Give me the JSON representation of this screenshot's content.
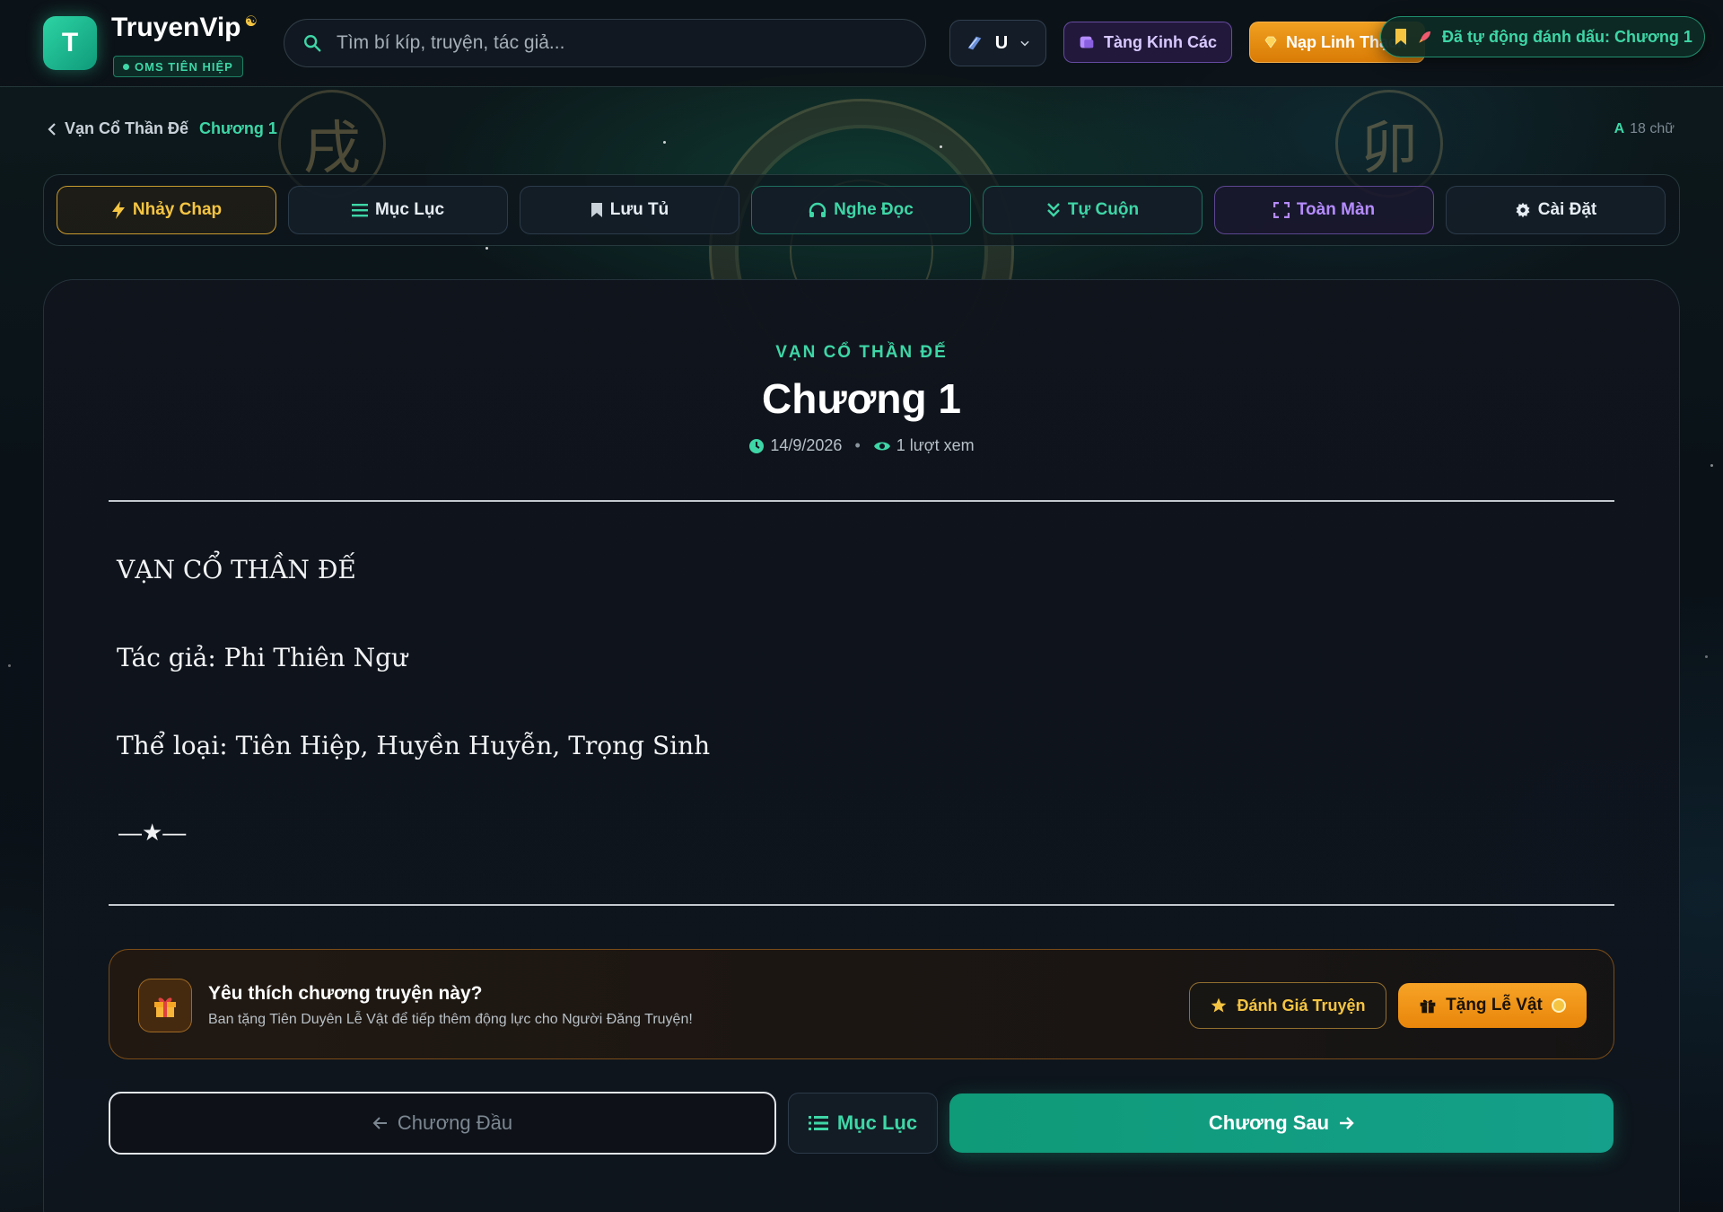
{
  "colors": {
    "accent": "#3ed6a6",
    "gold": "#f5c542",
    "orange": "#f0a020",
    "purple": "#b58cff",
    "background": "#0b1119"
  },
  "header": {
    "logo_letter": "T",
    "brand": "TruyenVip",
    "badge": "OMS TIÊN HIỆP",
    "search": {
      "placeholder": "Tìm bí kíp, truyện, tác giả..."
    },
    "user_label": "U",
    "kinh_cac_label": "Tàng Kinh Các",
    "nap_label": "Nạp Linh Thạch",
    "toast": "Đã tự động đánh dấu: Chương 1"
  },
  "breadcrumb": {
    "story": "Vạn Cổ Thần Đế",
    "chapter": "Chương 1"
  },
  "word_count": "18 chữ",
  "toolbar": {
    "jump": "Nhảy Chap",
    "toc": "Mục Lục",
    "save": "Lưu Tủ",
    "listen": "Nghe Đọc",
    "autoscroll": "Tự Cuộn",
    "fullscreen": "Toàn Màn",
    "settings": "Cài Đặt"
  },
  "chapter": {
    "story_name": "VẠN CỔ THẦN ĐẾ",
    "title": "Chương 1",
    "date": "14/9/2026",
    "views": "1 lượt xem",
    "paragraphs": [
      "VẠN CỔ THẦN ĐẾ",
      "Tác giả: Phi Thiên Ngư",
      "Thể loại: Tiên Hiệp, Huyền Huyễn, Trọng Sinh"
    ],
    "divider": "—★—"
  },
  "gift": {
    "title": "Yêu thích chương truyện này?",
    "subtitle": "Ban tặng Tiên Duyên Lễ Vật để tiếp thêm động lực cho Người Đăng Truyện!",
    "rate_label": "Đánh Giá Truyện",
    "gift_label": "Tặng Lễ Vật"
  },
  "nav": {
    "prev": "Chương Đầu",
    "toc": "Mục Lục",
    "next": "Chương Sau"
  },
  "icons": [
    "search-icon",
    "chevron-down-icon",
    "scroll-icon",
    "gem-icon",
    "bookmark-icon",
    "rocket-icon",
    "chevron-left-icon",
    "font-icon",
    "bolt-icon",
    "list-icon",
    "headphones-icon",
    "double-chevron-down-icon",
    "expand-icon",
    "gear-icon",
    "clock-icon",
    "eye-icon",
    "gift-icon",
    "star-icon",
    "arrow-left-icon",
    "arrow-right-icon"
  ]
}
